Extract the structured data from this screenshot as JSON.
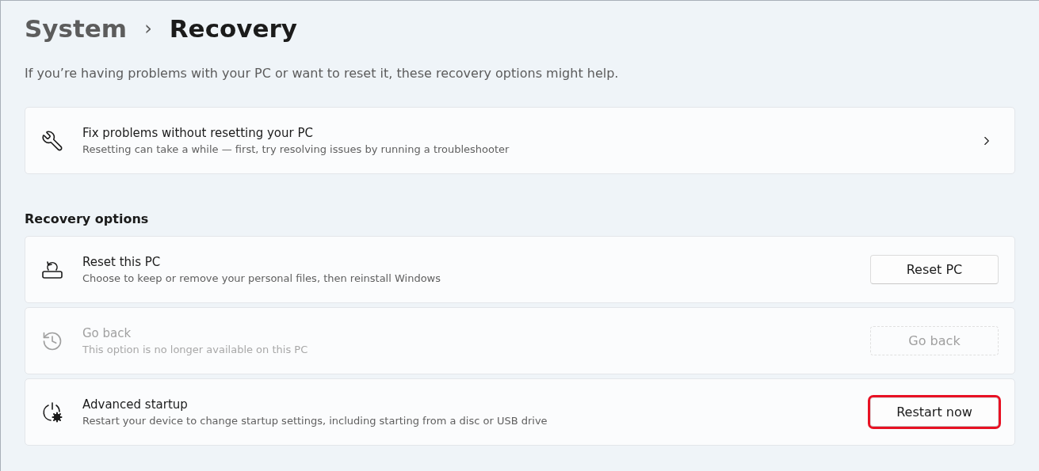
{
  "breadcrumb": {
    "parent": "System",
    "separator": "›",
    "current": "Recovery"
  },
  "description": "If you’re having problems with your PC or want to reset it, these recovery options might help.",
  "fix_card": {
    "title": "Fix problems without resetting your PC",
    "subtitle": "Resetting can take a while — first, try resolving issues by running a troubleshooter"
  },
  "section_title": "Recovery options",
  "options": [
    {
      "kind": "reset",
      "title": "Reset this PC",
      "subtitle": "Choose to keep or remove your personal files, then reinstall Windows",
      "button": "Reset PC",
      "disabled": false,
      "highlighted": false
    },
    {
      "kind": "history",
      "title": "Go back",
      "subtitle": "This option is no longer available on this PC",
      "button": "Go back",
      "disabled": true,
      "highlighted": false
    },
    {
      "kind": "power",
      "title": "Advanced startup",
      "subtitle": "Restart your device to change startup settings, including starting from a disc or USB drive",
      "button": "Restart now",
      "disabled": false,
      "highlighted": true
    }
  ]
}
